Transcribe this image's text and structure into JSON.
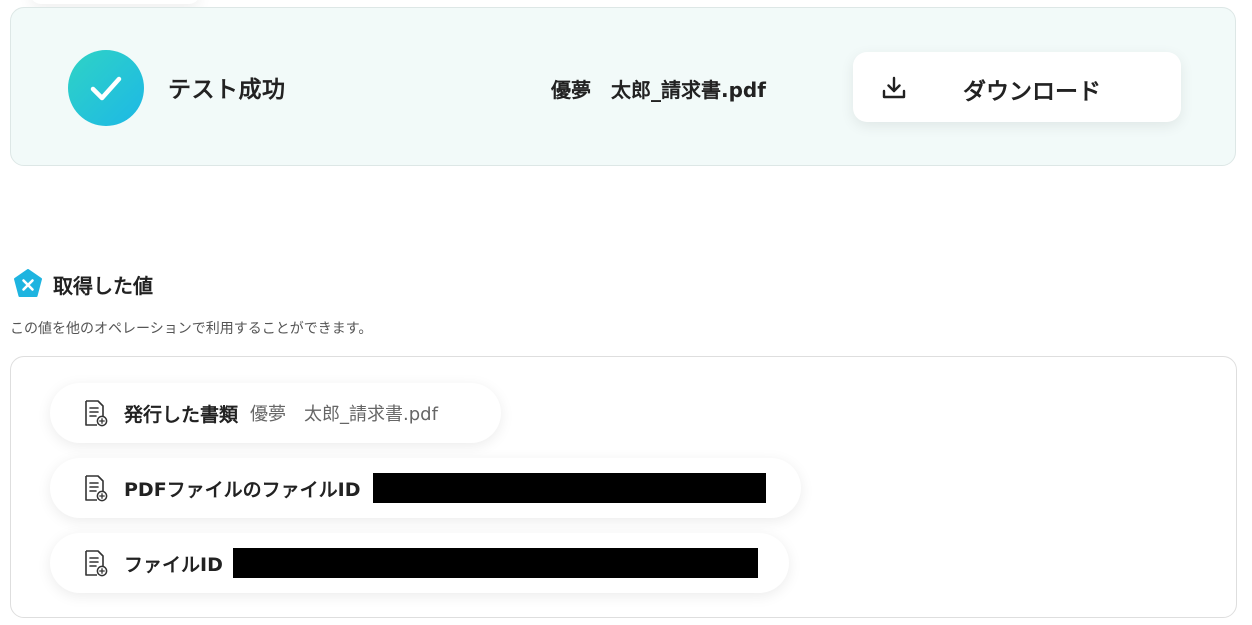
{
  "result": {
    "status_text": "テスト成功",
    "file_name": "優夢　太郎_請求書.pdf",
    "download_label": "ダウンロード",
    "status_icon": "check-circle-icon",
    "download_icon": "download-icon"
  },
  "values_section": {
    "title": "取得した値",
    "description": "この値を他のオペレーションで利用することができます。",
    "icon": "variable-x-icon",
    "items": [
      {
        "label": "発行した書類",
        "value": "優夢　太郎_請求書.pdf",
        "icon": "document-icon"
      },
      {
        "label": "PDFファイルのファイルID",
        "value": "",
        "redacted": true,
        "icon": "document-icon"
      },
      {
        "label": "ファイルID",
        "value": "",
        "redacted": true,
        "icon": "document-icon"
      }
    ]
  },
  "colors": {
    "accent_gradient_start": "#2fd3c5",
    "accent_gradient_end": "#1db8e6",
    "card_background": "#f2faf9",
    "redaction": "#000000"
  }
}
